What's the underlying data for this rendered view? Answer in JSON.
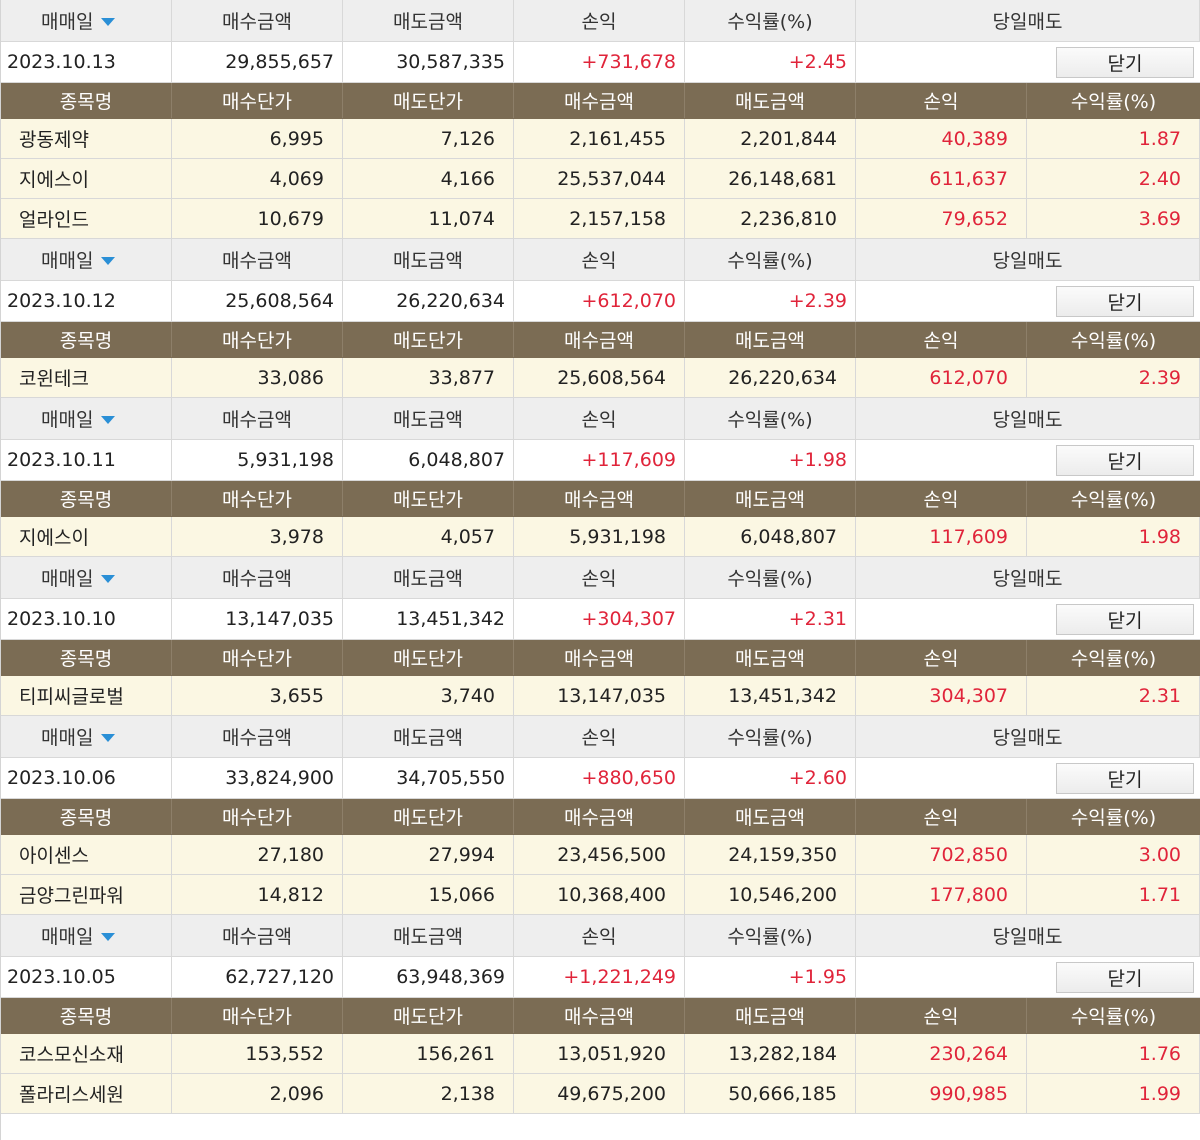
{
  "headers": {
    "summary": [
      "매매일",
      "매수금액",
      "매도금액",
      "손익",
      "수익률(%)",
      "당일매도"
    ],
    "detail": [
      "종목명",
      "매수단가",
      "매도단가",
      "매수금액",
      "매도금액",
      "손익",
      "수익률(%)"
    ],
    "close_label": "닫기"
  },
  "colors": {
    "header_brown": "#7b6c54",
    "profit_red": "#e0243a",
    "arrow_blue": "#2a8fd6",
    "row_cream": "#fbf7e3"
  },
  "days": [
    {
      "date": "2023.10.13",
      "buy": "29,855,657",
      "sell": "30,587,335",
      "pnl": "+731,678",
      "rate": "+2.45",
      "stocks": [
        {
          "name": "광동제약",
          "buy_price": "6,995",
          "sell_price": "7,126",
          "buy_amt": "2,161,455",
          "sell_amt": "2,201,844",
          "pnl": "40,389",
          "rate": "1.87"
        },
        {
          "name": "지에스이",
          "buy_price": "4,069",
          "sell_price": "4,166",
          "buy_amt": "25,537,044",
          "sell_amt": "26,148,681",
          "pnl": "611,637",
          "rate": "2.40"
        },
        {
          "name": "얼라인드",
          "buy_price": "10,679",
          "sell_price": "11,074",
          "buy_amt": "2,157,158",
          "sell_amt": "2,236,810",
          "pnl": "79,652",
          "rate": "3.69"
        }
      ]
    },
    {
      "date": "2023.10.12",
      "buy": "25,608,564",
      "sell": "26,220,634",
      "pnl": "+612,070",
      "rate": "+2.39",
      "stocks": [
        {
          "name": "코윈테크",
          "buy_price": "33,086",
          "sell_price": "33,877",
          "buy_amt": "25,608,564",
          "sell_amt": "26,220,634",
          "pnl": "612,070",
          "rate": "2.39"
        }
      ]
    },
    {
      "date": "2023.10.11",
      "buy": "5,931,198",
      "sell": "6,048,807",
      "pnl": "+117,609",
      "rate": "+1.98",
      "stocks": [
        {
          "name": "지에스이",
          "buy_price": "3,978",
          "sell_price": "4,057",
          "buy_amt": "5,931,198",
          "sell_amt": "6,048,807",
          "pnl": "117,609",
          "rate": "1.98"
        }
      ]
    },
    {
      "date": "2023.10.10",
      "buy": "13,147,035",
      "sell": "13,451,342",
      "pnl": "+304,307",
      "rate": "+2.31",
      "stocks": [
        {
          "name": "티피씨글로벌",
          "buy_price": "3,655",
          "sell_price": "3,740",
          "buy_amt": "13,147,035",
          "sell_amt": "13,451,342",
          "pnl": "304,307",
          "rate": "2.31"
        }
      ]
    },
    {
      "date": "2023.10.06",
      "buy": "33,824,900",
      "sell": "34,705,550",
      "pnl": "+880,650",
      "rate": "+2.60",
      "stocks": [
        {
          "name": "아이센스",
          "buy_price": "27,180",
          "sell_price": "27,994",
          "buy_amt": "23,456,500",
          "sell_amt": "24,159,350",
          "pnl": "702,850",
          "rate": "3.00"
        },
        {
          "name": "금양그린파워",
          "buy_price": "14,812",
          "sell_price": "15,066",
          "buy_amt": "10,368,400",
          "sell_amt": "10,546,200",
          "pnl": "177,800",
          "rate": "1.71"
        }
      ]
    },
    {
      "date": "2023.10.05",
      "buy": "62,727,120",
      "sell": "63,948,369",
      "pnl": "+1,221,249",
      "rate": "+1.95",
      "stocks": [
        {
          "name": "코스모신소재",
          "buy_price": "153,552",
          "sell_price": "156,261",
          "buy_amt": "13,051,920",
          "sell_amt": "13,282,184",
          "pnl": "230,264",
          "rate": "1.76"
        },
        {
          "name": "폴라리스세원",
          "buy_price": "2,096",
          "sell_price": "2,138",
          "buy_amt": "49,675,200",
          "sell_amt": "50,666,185",
          "pnl": "990,985",
          "rate": "1.99"
        }
      ]
    }
  ]
}
